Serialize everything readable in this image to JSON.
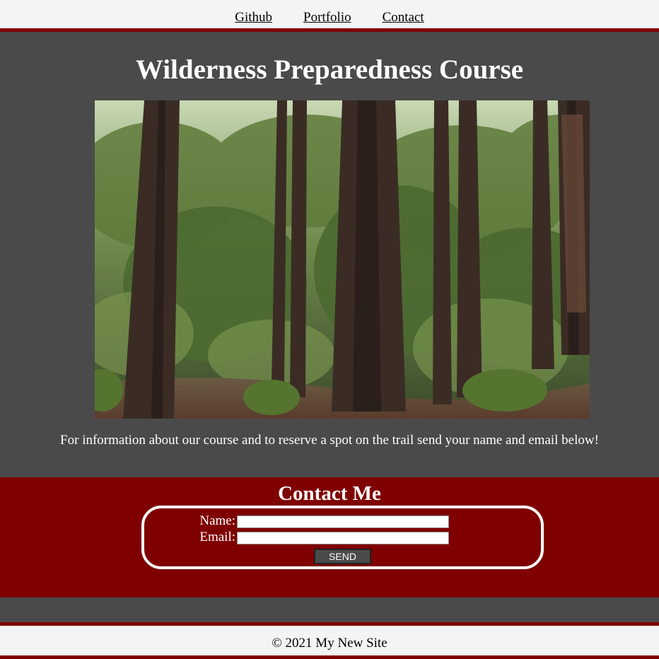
{
  "nav": {
    "links": [
      {
        "label": "Github"
      },
      {
        "label": "Portfolio"
      },
      {
        "label": "Contact"
      }
    ]
  },
  "hero": {
    "title": "Wilderness Preparedness Course",
    "image_subject": "redwood-forest-photo",
    "info_text": "For information about our course and to reserve a spot on the trail send your name and email below!"
  },
  "contact": {
    "heading": "Contact Me",
    "name_label": "Name:",
    "name_value": "",
    "email_label": "Email:",
    "email_value": "",
    "send_label": "SEND"
  },
  "footer": {
    "text": "© 2021 My New Site"
  },
  "colors": {
    "accent": "#7f0000",
    "main_bg": "#4a4a4a",
    "page_bg": "#f4f4f4"
  }
}
